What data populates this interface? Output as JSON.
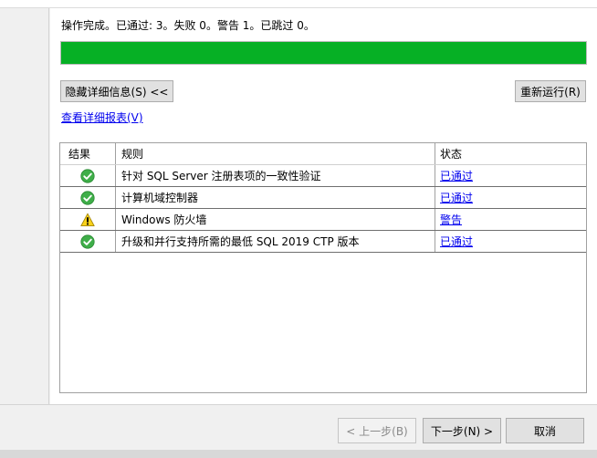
{
  "summary": {
    "status_text": "操作完成。已通过: 3。失败 0。警告 1。已跳过 0。",
    "progress_percent": 100,
    "progress_color": "#06b025"
  },
  "details": {
    "hide_details_label": "隐藏详细信息(S) <<",
    "rerun_label": "重新运行(R)",
    "view_report_label": "查看详细报表(V)"
  },
  "grid": {
    "columns": [
      "结果",
      "规则",
      "状态"
    ],
    "rows": [
      {
        "result_icon": "check-icon",
        "rule": "针对 SQL Server 注册表项的一致性验证",
        "status": "已通过"
      },
      {
        "result_icon": "check-icon",
        "rule": "计算机域控制器",
        "status": "已通过"
      },
      {
        "result_icon": "warning-icon",
        "rule": "Windows 防火墙",
        "status": "警告"
      },
      {
        "result_icon": "check-icon",
        "rule": "升级和并行支持所需的最低 SQL 2019 CTP 版本",
        "status": "已通过"
      }
    ]
  },
  "footer": {
    "back_label": "< 上一步(B)",
    "next_label": "下一步(N) >",
    "cancel_label": "取消"
  }
}
